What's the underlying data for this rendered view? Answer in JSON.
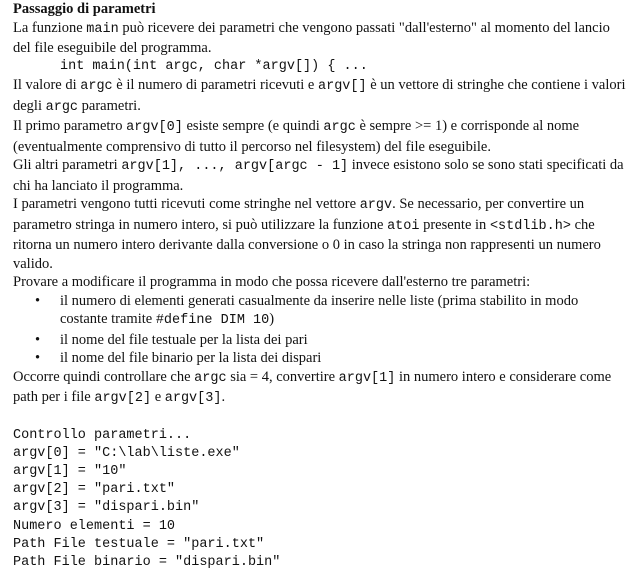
{
  "title": "Passaggio di parametri",
  "intro": {
    "t1": "La funzione ",
    "c1": "main",
    "t2": " può ricevere dei parametri che vengono passati \"dall'esterno\" al momento del lancio del file eseguibile del programma."
  },
  "signature": "int main(int argc, char *argv[]) { ...",
  "p_argc": {
    "t1": "Il valore di ",
    "c1": "argc",
    "t2": " è il numero di parametri ricevuti e ",
    "c2": "argv[]",
    "t3": " è un vettore di stringhe che contiene i valori degli ",
    "c3": "argc",
    "t4": " parametri."
  },
  "p_first": {
    "t1": "Il primo parametro ",
    "c1": "argv[0]",
    "t2": " esiste sempre (e quindi ",
    "c2": "argc",
    "t3": " è sempre >= 1) e corrisponde al nome (eventualmente comprensivo di tutto il percorso nel filesystem) del file eseguibile."
  },
  "p_others": {
    "t1": "Gli altri parametri ",
    "c1": "argv[1], ..., argv[argc - 1]",
    "t2": " invece esistono solo se sono stati specificati da chi ha lanciato il programma."
  },
  "p_strings": {
    "t1": "I parametri vengono tutti ricevuti come stringhe nel vettore ",
    "c1": "argv",
    "t2": ". Se necessario, per convertire un parametro stringa in numero intero, si può utilizzare la funzione ",
    "c2": "atoi",
    "t3": " presente in ",
    "c3": "<stdlib.h>",
    "t4": " che ritorna un numero intero derivante dalla conversione o 0 in caso la stringa non rappresenti un numero valido."
  },
  "p_try": "Provare a modificare il programma in modo che possa ricevere dall'esterno tre parametri:",
  "bullet_symbol": "•",
  "bullets": {
    "b1": {
      "t1": "il numero di elementi generati casualmente da inserire nelle liste (prima stabilito in modo costante tramite ",
      "c1": "#define DIM 10",
      "t2": ")"
    },
    "b2": "il nome del file testuale per la lista dei pari",
    "b3": "il nome del file binario per la lista dei dispari"
  },
  "p_check": {
    "t1": "Occorre quindi controllare che ",
    "c1": "argc",
    "t2": " sia = 4, convertire ",
    "c2": "argv[1]",
    "t3": " in numero intero e considerare come path per i file ",
    "c3": "argv[2]",
    "t4": " e ",
    "c4": "argv[3]",
    "t5": "."
  },
  "console": [
    "Controllo parametri...",
    "argv[0] = \"C:\\lab\\liste.exe\"",
    "argv[1] = \"10\"",
    "argv[2] = \"pari.txt\"",
    "argv[3] = \"dispari.bin\"",
    "Numero elementi = 10",
    "Path File testuale = \"pari.txt\"",
    "Path File binario = \"dispari.bin\""
  ]
}
